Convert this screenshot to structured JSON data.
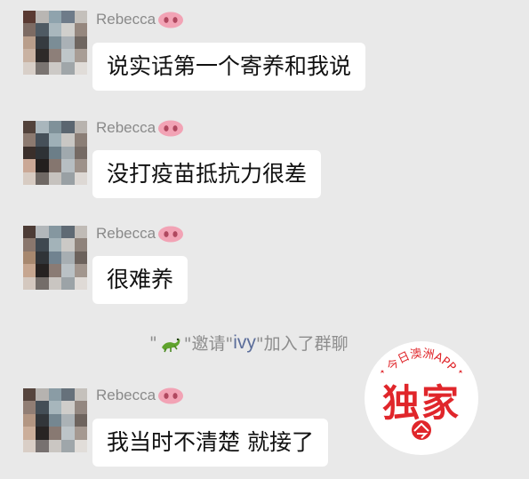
{
  "messages": [
    {
      "sender": "Rebecca",
      "text": "说实话第一个寄养和我说"
    },
    {
      "sender": "Rebecca",
      "text": "没打疫苗抵抗力很差"
    },
    {
      "sender": "Rebecca",
      "text": "很难养"
    },
    {
      "sender": "Rebecca",
      "text": "我当时不清楚 就接了"
    }
  ],
  "system_notice": {
    "icon": "lizard-emoji-icon",
    "q1": "\"",
    "pre": "\"邀请\"",
    "invitee": "ivy",
    "post": "\"加入了群聊"
  },
  "watermark": {
    "arc_text": "今日澳洲APP",
    "title": "独家",
    "logo": "jinri-logo-icon",
    "color": "#e0262b"
  },
  "colors": {
    "background": "#e9e9e9",
    "bubble": "#ffffff",
    "sender_name": "#8a8a8a",
    "invitee": "#5b6d9a"
  }
}
